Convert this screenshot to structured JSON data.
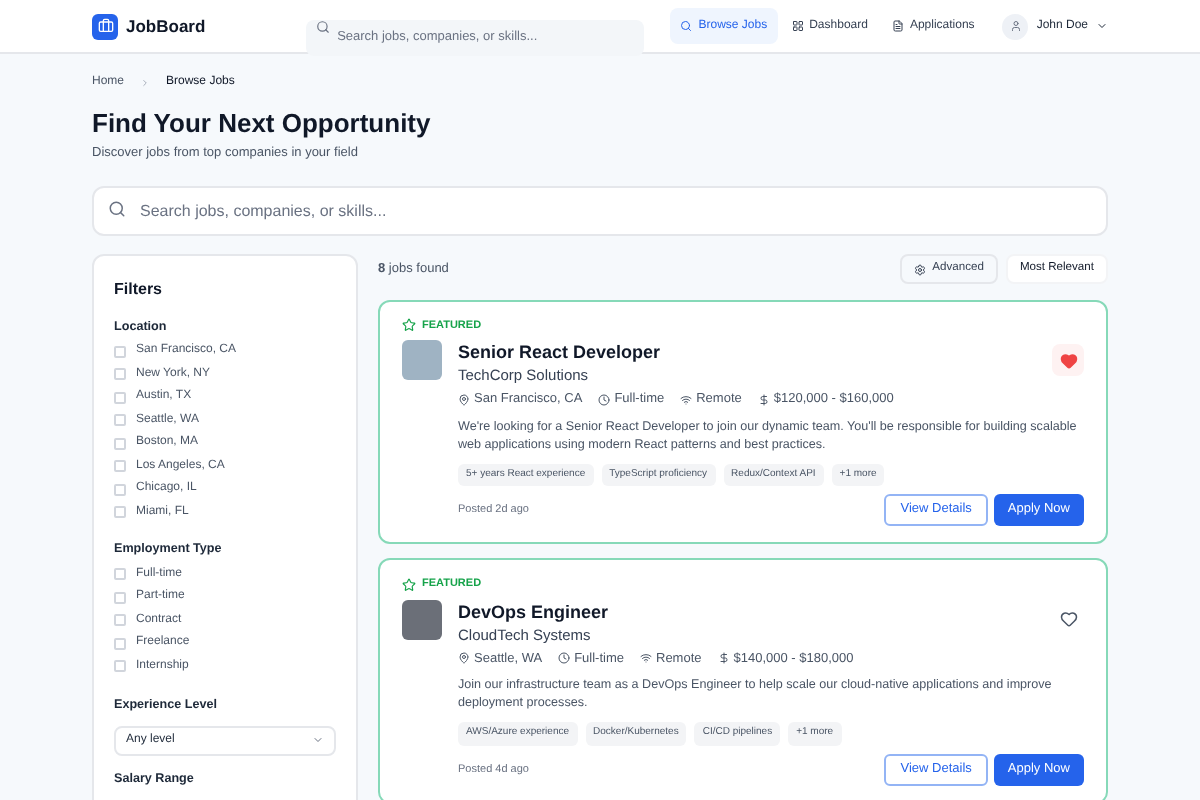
{
  "header": {
    "logo": "JobBoard",
    "search": {
      "placeholder": "Search jobs, companies, or skills..."
    },
    "nav": [
      {
        "label": "Browse Jobs",
        "selected": true
      },
      {
        "label": "Dashboard",
        "selected": false
      },
      {
        "label": "Applications",
        "selected": false
      }
    ],
    "user": "John Doe"
  },
  "breadcrumb": [
    "Home",
    "Browse Jobs"
  ],
  "title": "Find Your Next Opportunity",
  "subtitle": "Discover jobs from top companies in your field",
  "main_search": {
    "placeholder": "Search jobs, companies, or skills..."
  },
  "filters": {
    "title": "Filters",
    "groups": [
      {
        "title": "Location",
        "options": [
          {
            "label": "San Francisco, CA",
            "checked": false
          },
          {
            "label": "New York, NY",
            "checked": false
          },
          {
            "label": "Austin, TX",
            "checked": false
          },
          {
            "label": "Seattle, WA",
            "checked": false
          },
          {
            "label": "Boston, MA",
            "checked": false
          },
          {
            "label": "Los Angeles, CA",
            "checked": false
          },
          {
            "label": "Chicago, IL",
            "checked": false
          },
          {
            "label": "Miami, FL",
            "checked": false
          }
        ]
      },
      {
        "title": "Employment Type",
        "options": [
          {
            "label": "Full-time",
            "checked": false
          },
          {
            "label": "Part-time",
            "checked": false
          },
          {
            "label": "Contract",
            "checked": false
          },
          {
            "label": "Freelance",
            "checked": false
          },
          {
            "label": "Internship",
            "checked": false
          }
        ]
      }
    ],
    "experience": {
      "title": "Experience Level",
      "value": "Any level"
    },
    "salary_title": "Salary Range"
  },
  "results": {
    "count": "**8** jobs found",
    "advanced": "Advanced",
    "sort": "Most Relevant"
  },
  "jobs": [
    {
      "featured": true,
      "badge": "FEATURED",
      "title": "Senior React Developer",
      "company": "TechCorp Solutions",
      "saved": true,
      "location": "San Francisco, CA",
      "type": "Full-time",
      "remote": "Remote",
      "salary": "$120,000 - $160,000",
      "description": "We're looking for a Senior React Developer to join our dynamic team. You'll be responsible for building scalable web applications using modern React patterns and best practices.",
      "tags": [
        "5+ years React experience",
        "TypeScript proficiency",
        "Redux/Context API",
        "+1 more"
      ],
      "posted": "Posted 2d ago",
      "details": "View Details",
      "apply": "Apply Now"
    },
    {
      "featured": true,
      "badge": "FEATURED",
      "title": "DevOps Engineer",
      "company": "CloudTech Systems",
      "saved": false,
      "location": "Seattle, WA",
      "type": "Full-time",
      "remote": "Remote",
      "salary": "$140,000 - $180,000",
      "description": "Join our infrastructure team as a DevOps Engineer to help scale our cloud-native applications and improve deployment processes.",
      "tags": [
        "AWS/Azure experience",
        "Docker/Kubernetes",
        "CI/CD pipelines",
        "+1 more"
      ],
      "posted": "Posted 4d ago",
      "details": "View Details",
      "apply": "Apply Now"
    }
  ]
}
